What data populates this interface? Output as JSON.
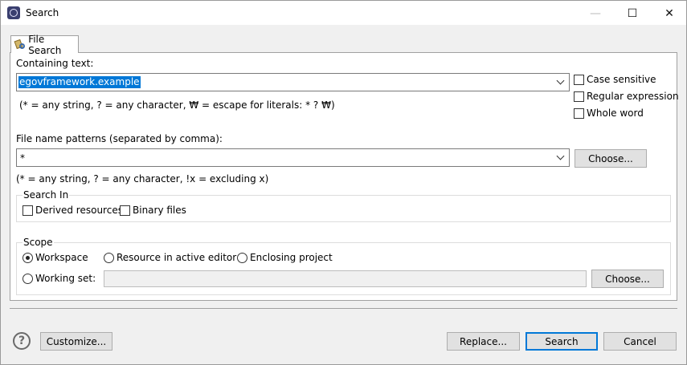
{
  "window": {
    "title": "Search",
    "minimize_glyph": "—",
    "maximize_glyph": "☐",
    "close_glyph": "✕"
  },
  "tab": {
    "label": "File Search",
    "icon": "file-search-icon"
  },
  "containing_text": {
    "label": "Containing text:",
    "value": "egovframework.example",
    "hint": "(* = any string, ? = any character, ₩ = escape for literals: * ? ₩)"
  },
  "options": {
    "case_sensitive": {
      "label": "Case sensitive",
      "checked": false
    },
    "regular_expression": {
      "label": "Regular expression",
      "checked": false
    },
    "whole_word": {
      "label": "Whole word",
      "checked": false
    }
  },
  "file_name_patterns": {
    "label": "File name patterns (separated by comma):",
    "value": "*",
    "hint": "(* = any string, ? = any character, !x = excluding x)",
    "choose_label": "Choose..."
  },
  "search_in": {
    "title": "Search In",
    "derived_resources": {
      "label": "Derived resources",
      "checked": false
    },
    "binary_files": {
      "label": "Binary files",
      "checked": false
    }
  },
  "scope": {
    "title": "Scope",
    "workspace": {
      "label": "Workspace",
      "selected": true
    },
    "resource_in_active_editor": {
      "label": "Resource in active editor",
      "selected": false
    },
    "enclosing_project": {
      "label": "Enclosing project",
      "selected": false
    },
    "working_set": {
      "label": "Working set:",
      "selected": false,
      "value": ""
    },
    "choose_label": "Choose..."
  },
  "footer": {
    "help_glyph": "?",
    "customize_label": "Customize...",
    "replace_label": "Replace...",
    "search_label": "Search",
    "cancel_label": "Cancel"
  }
}
